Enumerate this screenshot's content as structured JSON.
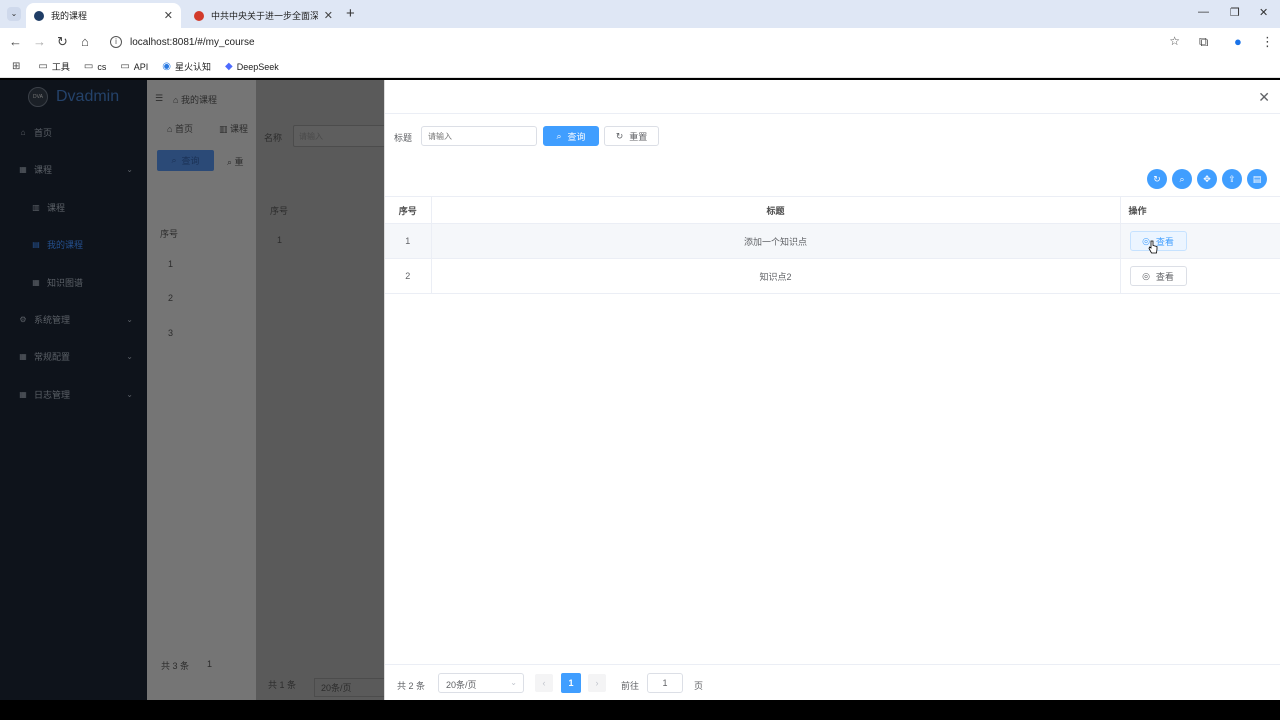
{
  "browser": {
    "tabs": [
      {
        "title": "我的课程",
        "active": true
      },
      {
        "title": "中共中央关于进一步全面深化改",
        "active": false
      }
    ],
    "url": "localhost:8081/#/my_course",
    "bookmarks": [
      "工具",
      "cs",
      "API",
      "星火认知",
      "DeepSeek"
    ]
  },
  "sidebar": {
    "app_name": "Dvadmin",
    "logo_text": "DVA",
    "items": [
      {
        "label": "首页",
        "icon": "home-icon"
      },
      {
        "label": "课程",
        "icon": "grid-icon"
      },
      {
        "label": "课程",
        "icon": "bar-chart-icon"
      },
      {
        "label": "我的课程",
        "icon": "chart-icon"
      },
      {
        "label": "知识图谱",
        "icon": "grid-icon"
      },
      {
        "label": "系统管理",
        "icon": "gear-icon"
      },
      {
        "label": "常规配置",
        "icon": "grid-icon"
      },
      {
        "label": "日志管理",
        "icon": "grid-icon"
      }
    ]
  },
  "background_page": {
    "breadcrumb": "我的课程",
    "tabs": [
      "首页",
      "课程"
    ],
    "search_button": "查询",
    "reset_button_partial": "重",
    "col_index": "序号",
    "rows": [
      "1",
      "2",
      "3"
    ],
    "total_text": "共 3 条",
    "page_partial": "1"
  },
  "background_drawer": {
    "name_label": "名称",
    "name_placeholder": "请输入",
    "col_index": "序号",
    "rows": [
      "1"
    ],
    "total_text": "共 1 条",
    "page_size": "20条/页"
  },
  "drawer": {
    "search": {
      "label": "标题",
      "placeholder": "请输入",
      "query_button": "查询",
      "reset_button": "重置"
    },
    "table": {
      "headers": {
        "index": "序号",
        "title": "标题",
        "actions": "操作"
      },
      "rows": [
        {
          "index": "1",
          "title": "添加一个知识点",
          "action": "查看"
        },
        {
          "index": "2",
          "title": "知识点2",
          "action": "查看"
        }
      ]
    },
    "pagination": {
      "total_text": "共 2 条",
      "page_size": "20条/页",
      "current_page": "1",
      "goto_label": "前往",
      "goto_value": "1",
      "page_suffix": "页"
    }
  },
  "colors": {
    "primary": "#409eff",
    "sidebar_bg": "#0e131b"
  }
}
